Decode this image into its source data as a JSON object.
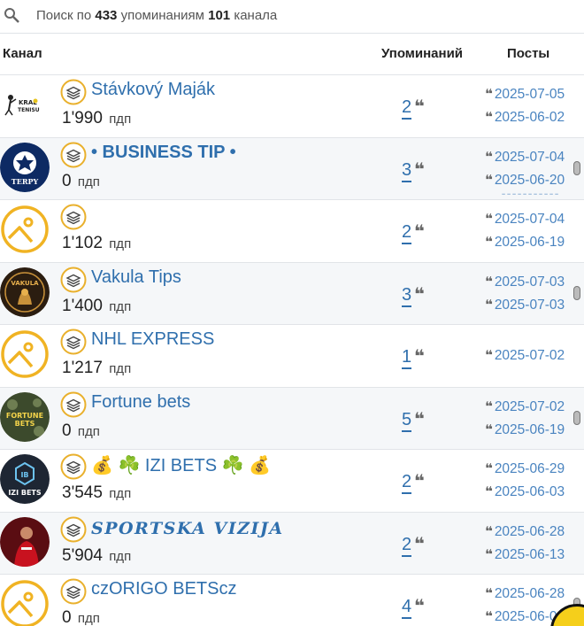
{
  "search": {
    "prefix": "Поиск по ",
    "mentions_count": "433",
    "middle": " упоминаниям ",
    "channels_count": "101",
    "suffix": " канала"
  },
  "table": {
    "headers": {
      "channel": "Канал",
      "mentions": "Упоминаний",
      "posts": "Посты"
    },
    "subs_unit": "пдп",
    "rows": [
      {
        "title": "Stávkový Maják",
        "subs": "1'990",
        "mentions": "2",
        "posts": [
          "2025-07-05",
          "2025-06-02"
        ],
        "avatar": "kral-tenisu-logo",
        "scroll": false
      },
      {
        "title": "• BUSINESS TIP •",
        "subs": "0",
        "mentions": "3",
        "posts": [
          "2025-07-04",
          "2025-06-20"
        ],
        "avatar": "terpy-champions-logo",
        "scroll": true
      },
      {
        "title": "",
        "subs": "1'102",
        "mentions": "2",
        "posts": [
          "2025-07-04",
          "2025-06-19"
        ],
        "avatar": "placeholder-image-icon",
        "scroll": false
      },
      {
        "title": "Vakula Tips",
        "subs": "1'400",
        "mentions": "3",
        "posts": [
          "2025-07-03",
          "2025-07-03"
        ],
        "avatar": "vakula-logo",
        "scroll": true
      },
      {
        "title": "NHL EXPRESS",
        "subs": "1'217",
        "mentions": "1",
        "posts": [
          "2025-07-02"
        ],
        "avatar": "placeholder-image-icon",
        "scroll": false
      },
      {
        "title": "Fortune bets",
        "subs": "0",
        "mentions": "5",
        "posts": [
          "2025-07-02",
          "2025-06-19"
        ],
        "avatar": "fortune-bets-logo",
        "scroll": true
      },
      {
        "title": "💰 ☘️ IZI BETS ☘️ 💰",
        "subs": "3'545",
        "mentions": "2",
        "posts": [
          "2025-06-29",
          "2025-06-03"
        ],
        "avatar": "izi-bets-logo",
        "scroll": false
      },
      {
        "title": "SPORTSKA VIZIJA",
        "subs": "5'904",
        "mentions": "2",
        "posts": [
          "2025-06-28",
          "2025-06-13"
        ],
        "avatar": "football-player-photo",
        "scroll": false
      },
      {
        "title": "czORIGO BETScz",
        "subs": "0",
        "mentions": "4",
        "posts": [
          "2025-06-28",
          "2025-06-0"
        ],
        "avatar": "placeholder-image-icon",
        "scroll": true
      }
    ]
  },
  "colors": {
    "link": "#2f6fad",
    "date": "#4a84c0",
    "placeholder_icon": "#f0b323",
    "row_shade": "#f5f7f9"
  }
}
